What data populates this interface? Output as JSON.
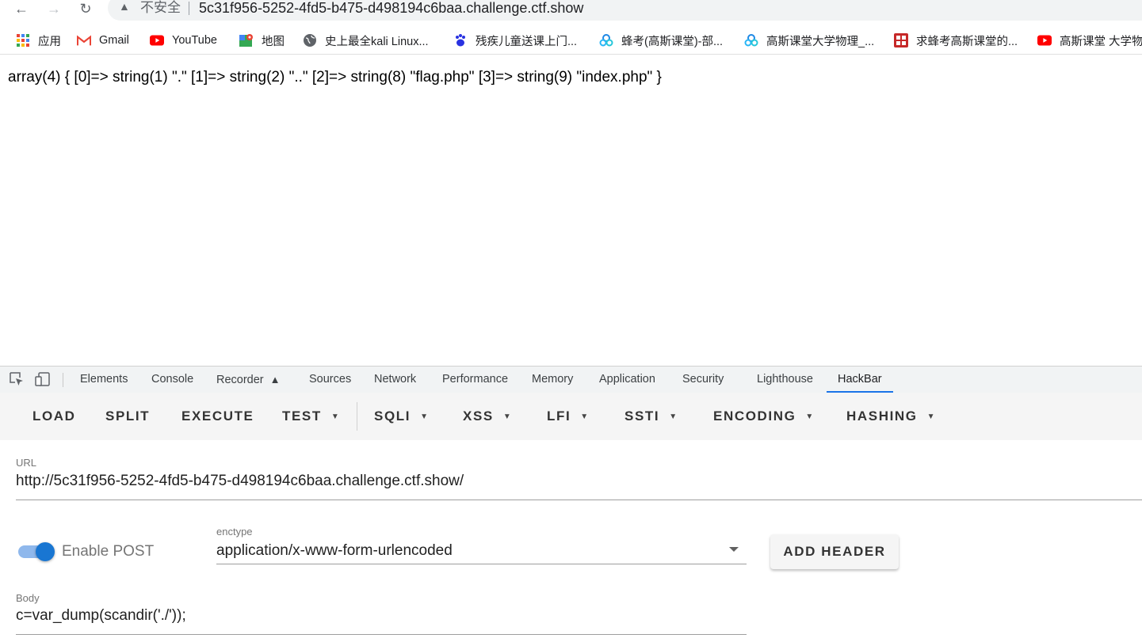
{
  "browser": {
    "security_label": "不安全",
    "address": "5c31f956-5252-4fd5-b475-d498194c6baa.challenge.ctf.show"
  },
  "bookmarks": [
    {
      "label": "应用",
      "icon": "apps-grid-icon"
    },
    {
      "label": "Gmail",
      "icon": "gmail-icon"
    },
    {
      "label": "YouTube",
      "icon": "youtube-icon"
    },
    {
      "label": "地图",
      "icon": "maps-icon"
    },
    {
      "label": "史上最全kali Linux...",
      "icon": "globe-icon"
    },
    {
      "label": "残疾儿童送课上门...",
      "icon": "baidu-paw-icon"
    },
    {
      "label": "蜂考(高斯课堂)-部...",
      "icon": "bilibili-cloud-icon"
    },
    {
      "label": "高斯课堂大学物理_...",
      "icon": "bilibili-cloud-icon"
    },
    {
      "label": "求蜂考高斯课堂的...",
      "icon": "forum-icon"
    },
    {
      "label": "高斯课堂 大学物",
      "icon": "youtube-icon"
    }
  ],
  "page": {
    "output": "array(4) { [0]=> string(1) \".\" [1]=> string(2) \"..\" [2]=> string(8) \"flag.php\" [3]=> string(9) \"index.php\" }"
  },
  "devtools": {
    "tabs": [
      "Elements",
      "Console",
      "Recorder",
      "Sources",
      "Network",
      "Performance",
      "Memory",
      "Application",
      "Security",
      "Lighthouse",
      "HackBar"
    ],
    "active_tab": "HackBar"
  },
  "hackbar": {
    "buttons": [
      "LOAD",
      "SPLIT",
      "EXECUTE",
      "TEST",
      "SQLI",
      "XSS",
      "LFI",
      "SSTI",
      "ENCODING",
      "HASHING"
    ],
    "url_label": "URL",
    "url_value": "http://5c31f956-5252-4fd5-b475-d498194c6baa.challenge.ctf.show/",
    "enable_post_label": "Enable POST",
    "enable_post": true,
    "enctype_label": "enctype",
    "enctype_value": "application/x-www-form-urlencoded",
    "add_header_label": "ADD HEADER",
    "body_label": "Body",
    "body_value": "c=var_dump(scandir('./'));"
  },
  "colors": {
    "accent": "#1a73e8",
    "toggle": "#1976d2"
  }
}
